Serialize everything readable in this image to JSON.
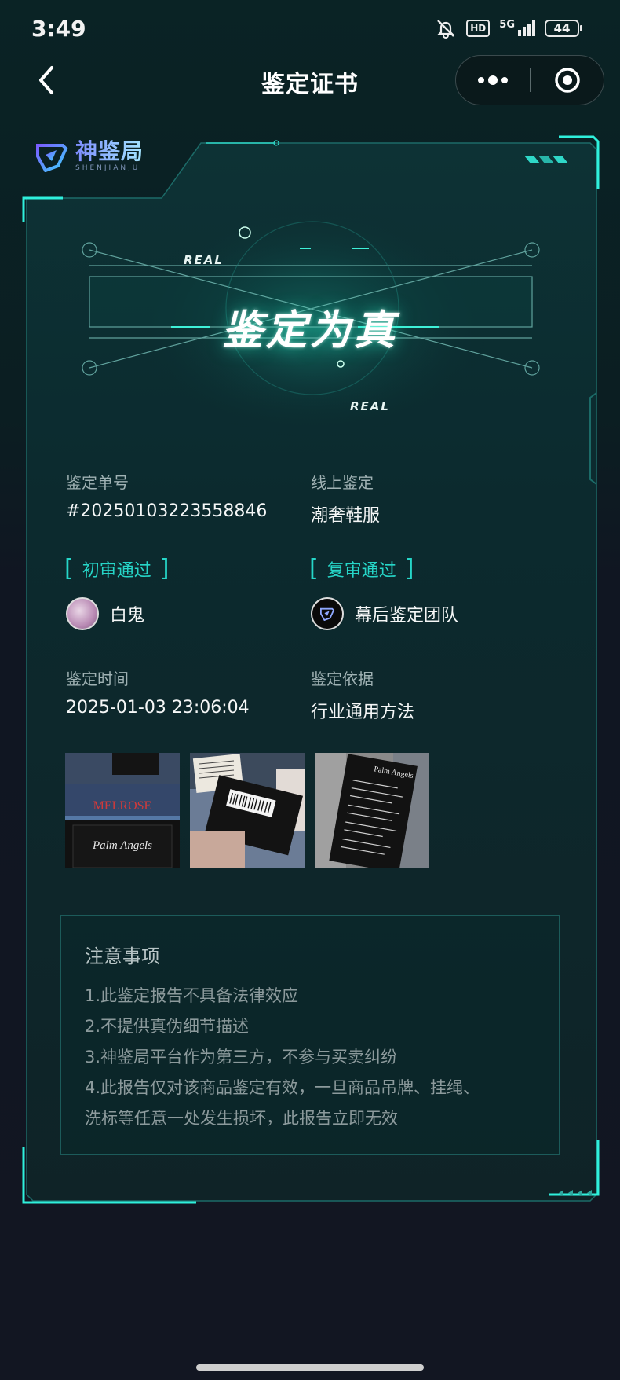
{
  "status_bar": {
    "time": "3:49",
    "hd": "HD",
    "network": "5G",
    "battery": "44"
  },
  "nav": {
    "title": "鉴定证书",
    "back_icon": "chevron-left-icon",
    "more_icon": "more-dots-icon",
    "close_icon": "target-close-icon"
  },
  "logo": {
    "name_cn": "神鉴局",
    "name_en": "SHENJIANJU"
  },
  "verdict": {
    "text": "鉴定为真",
    "tag_top": "REAL",
    "tag_bottom": "REAL",
    "accent": "#1fd8b8"
  },
  "info": {
    "order_label": "鉴定单号",
    "order_value": "#20250103223558846",
    "type_label": "线上鉴定",
    "type_value": "潮奢鞋服",
    "first_review_tag": "初审通过",
    "first_reviewer": "白鬼",
    "second_review_tag": "复审通过",
    "second_reviewer": "幕后鉴定团队",
    "time_label": "鉴定时间",
    "time_value": "2025-01-03 23:06:04",
    "basis_label": "鉴定依据",
    "basis_value": "行业通用方法"
  },
  "photos": [
    {
      "label": "MELROSE",
      "sub": "Palm Angels"
    },
    {
      "label": ""
    },
    {
      "label": "Palm Angels"
    }
  ],
  "notes": {
    "title": "注意事项",
    "lines": [
      "1.此鉴定报告不具备法律效应",
      "2.不提供真伪细节描述",
      "3.神鉴局平台作为第三方，不参与买卖纠纷",
      "4.此报告仅对该商品鉴定有效，一旦商品吊牌、挂绳、",
      "洗标等任意一处发生损坏，此报告立即无效"
    ]
  },
  "colors": {
    "frame": "#1fd8c8",
    "panel": "#0c2a2d",
    "tag": "#26d6c8"
  }
}
